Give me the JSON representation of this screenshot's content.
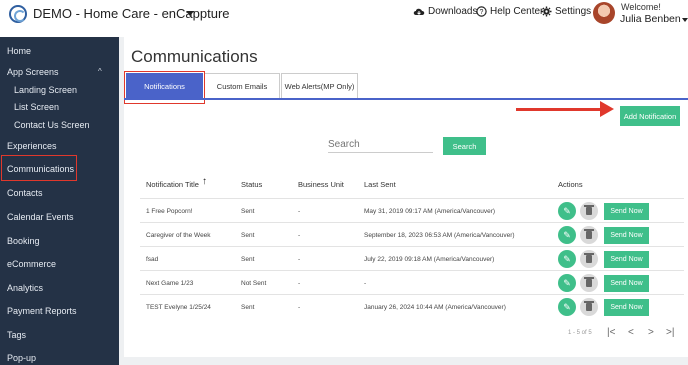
{
  "app": {
    "title": "DEMO - Home Care - enCappture"
  },
  "topnav": {
    "downloads": "Downloads",
    "help": "Help Center",
    "settings": "Settings",
    "welcome": "Welcome!",
    "user_name": "Julia Benben"
  },
  "sidebar": {
    "items": [
      {
        "label": "Home"
      },
      {
        "label": "App Screens"
      },
      {
        "label": "Landing Screen"
      },
      {
        "label": "List Screen"
      },
      {
        "label": "Contact Us Screen"
      },
      {
        "label": "Experiences"
      },
      {
        "label": "Communications"
      },
      {
        "label": "Contacts"
      },
      {
        "label": "Calendar Events"
      },
      {
        "label": "Booking"
      },
      {
        "label": "eCommerce"
      },
      {
        "label": "Analytics"
      },
      {
        "label": "Payment Reports"
      },
      {
        "label": "Tags"
      },
      {
        "label": "Pop-up"
      }
    ]
  },
  "page": {
    "title": "Communications"
  },
  "tabs": [
    {
      "label": "Notifications"
    },
    {
      "label": "Custom Emails"
    },
    {
      "label": "Web Alerts(MP Only)"
    }
  ],
  "actions": {
    "add_notification": "Add Notification"
  },
  "search": {
    "placeholder": "Search",
    "button": "Search"
  },
  "table": {
    "headers": [
      "Notification Title",
      "Status",
      "Business Unit",
      "Last Sent",
      "Actions"
    ],
    "rows": [
      {
        "title": "1 Free Popcorn!",
        "status": "Sent",
        "unit": "-",
        "last_sent": "May 31, 2019 09:17 AM (America/Vancouver)",
        "send": "Send Now"
      },
      {
        "title": "Caregiver of the Week",
        "status": "Sent",
        "unit": "-",
        "last_sent": "September 18, 2023 06:53 AM (America/Vancouver)",
        "send": "Send Now"
      },
      {
        "title": "fsad",
        "status": "Sent",
        "unit": "-",
        "last_sent": "July 22, 2019 09:18 AM (America/Vancouver)",
        "send": "Send Now"
      },
      {
        "title": "Next Game 1/23",
        "status": "Not Sent",
        "unit": "-",
        "last_sent": "-",
        "send": "Send Now"
      },
      {
        "title": "TEST Evelyne 1/25/24",
        "status": "Sent",
        "unit": "-",
        "last_sent": "January 26, 2024 10:44 AM (America/Vancouver)",
        "send": "Send Now"
      }
    ]
  },
  "pager": {
    "summary": "1 - 5 of 5",
    "first": "|<",
    "prev": "<",
    "next": ">",
    "last": ">|"
  },
  "colors": {
    "sidebar": "#243246",
    "accent": "#4a63c9",
    "green": "#3fbf8a",
    "highlight": "#e0382c"
  }
}
